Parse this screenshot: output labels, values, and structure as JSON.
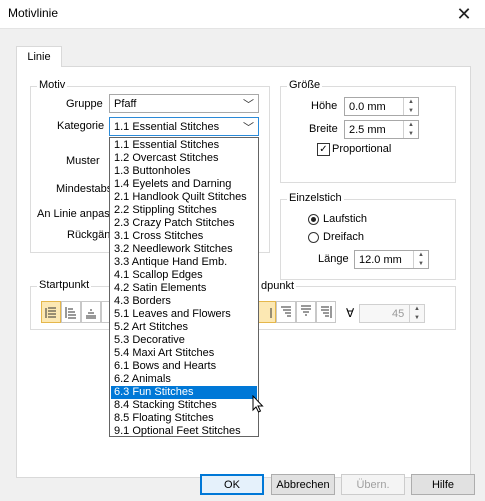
{
  "window": {
    "title": "Motivlinie"
  },
  "tabs": [
    {
      "label": "Linie"
    }
  ],
  "motiv": {
    "title": "Motiv",
    "gruppe_label": "Gruppe",
    "gruppe_value": "Pfaff",
    "kategorie_label": "Kategorie",
    "kategorie_value": "1.1 Essential Stitches",
    "muster_label": "Muster",
    "mindestabstand_label": "Mindestabs",
    "an_linie_label": "An Linie anpass",
    "rueckgang_label": "Rückgän"
  },
  "groesse": {
    "title": "Größe",
    "hoehe_label": "Höhe",
    "hoehe_value": "0.0 mm",
    "breite_label": "Breite",
    "breite_value": "2.5 mm",
    "proportional_label": "Proportional",
    "proportional_checked": true
  },
  "einzelstich": {
    "title": "Einzelstich",
    "laufstich_label": "Laufstich",
    "dreifach_label": "Dreifach",
    "selected": "Laufstich",
    "laenge_label": "Länge",
    "laenge_value": "12.0 mm"
  },
  "startpunkt": {
    "title": "Startpunkt"
  },
  "endpunkt": {
    "title": "dpunkt",
    "angle_value": "45"
  },
  "kategorie_options": [
    "1.1 Essential Stitches",
    "1.2 Overcast Stitches",
    "1.3 Buttonholes",
    "1.4 Eyelets and Darning",
    "2.1 Handlook Quilt Stitches",
    "2.2 Stippling Stitches",
    "2.3 Crazy Patch Stitches",
    "3.1 Cross Stitches",
    "3.2 Needlework Stitches",
    "3.3 Antique Hand Emb.",
    "4.1 Scallop Edges",
    "4.2 Satin Elements",
    "4.3 Borders",
    "5.1 Leaves and Flowers",
    "5.2 Art Stitches",
    "5.3 Decorative",
    "5.4 Maxi Art Stitches",
    "6.1 Bows and Hearts",
    "6.2 Animals",
    "6.3 Fun Stitches",
    "8.4 Stacking Stitches",
    "8.5 Floating Stitches",
    "9.1 Optional Feet Stitches"
  ],
  "kategorie_highlighted": "6.3 Fun Stitches",
  "buttons": {
    "ok": "OK",
    "abbrechen": "Abbrechen",
    "uebernehmen": "Übern.",
    "hilfe": "Hilfe"
  },
  "colors": {
    "accent": "#0078d7",
    "selected_align": "#fce8b3"
  }
}
